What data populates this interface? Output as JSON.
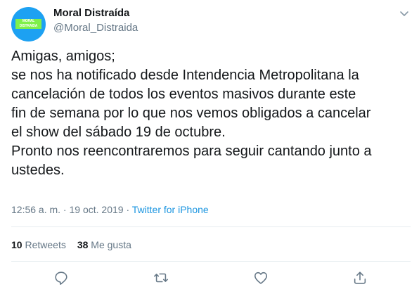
{
  "author": {
    "display_name": "Moral Distraída",
    "handle": "@Moral_Distraida",
    "avatar_logo_text": "MORAL DISTRAIDA",
    "avatar_color": "#1da1f2",
    "avatar_logo_color": "#7ff04a"
  },
  "tweet": {
    "lines": [
      "Amigas, amigos;",
      "se nos ha notificado desde Intendencia Metropolitana la",
      "cancelación de todos los eventos masivos durante este",
      "fin de semana por lo que nos vemos obligados a cancelar",
      "el show del sábado 19 de octubre.",
      "Pronto nos reencontraremos para seguir cantando junto a",
      "ustedes."
    ]
  },
  "meta": {
    "time": "12:56 a. m.",
    "separator": " · ",
    "date": "19 oct. 2019",
    "source": "Twitter for iPhone"
  },
  "stats": {
    "retweets_count": "10",
    "retweets_label": "Retweets",
    "likes_count": "38",
    "likes_label": "Me gusta"
  },
  "actions": {
    "icons": [
      "reply-icon",
      "retweet-icon",
      "like-icon",
      "share-icon"
    ]
  },
  "colors": {
    "text": "#14171a",
    "secondary": "#657786",
    "link": "#1b95e0",
    "divider": "#e6ecf0"
  }
}
